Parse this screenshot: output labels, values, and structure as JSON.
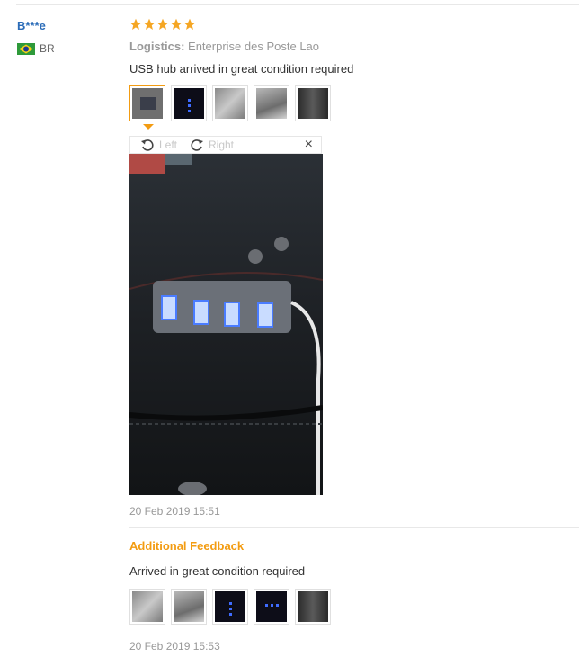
{
  "review": {
    "buyer_name": "B***e",
    "country_code": "BR",
    "rating": 5,
    "logistics_label": "Logistics:",
    "logistics_value": "Enterprise des Poste Lao",
    "text": "USB hub arrived in great condition required",
    "date": "20 Feb 2019 15:51",
    "thumbnails": [
      "hub-photo",
      "hub-lit",
      "hub-grey",
      "hub-grey-2",
      "hub-dark"
    ],
    "selected_thumbnail": 0
  },
  "viewer": {
    "rotate_left": "Left",
    "rotate_right": "Right",
    "close": "×"
  },
  "additional": {
    "title": "Additional Feedback",
    "text": "Arrived in great condition required",
    "date": "20 Feb 2019 15:53",
    "thumbnails": [
      "hub-grey",
      "hub-grey-2",
      "hub-lit",
      "hub-lit-2",
      "hub-dark"
    ]
  },
  "colors": {
    "star": "#f5a623",
    "accent": "#f39c12",
    "buyer_link": "#2b6cb8"
  }
}
